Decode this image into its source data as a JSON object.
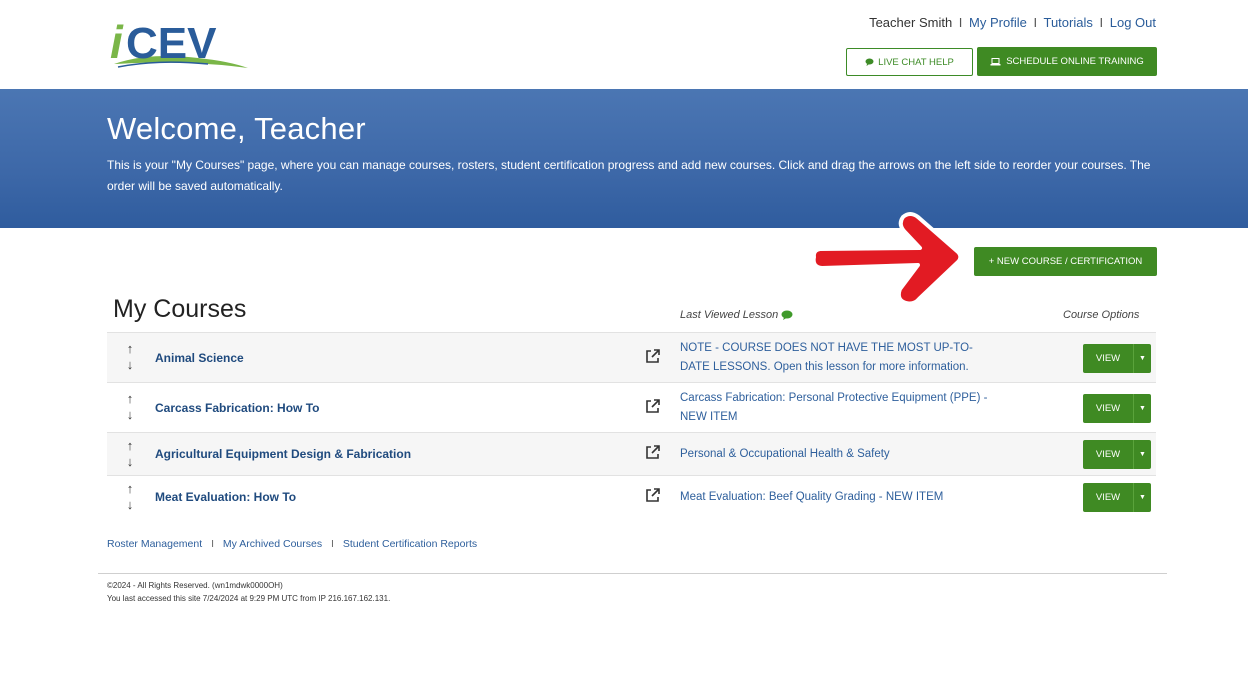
{
  "header": {
    "logo_text": "iCEV",
    "user_name": "Teacher Smith",
    "links": [
      "My Profile",
      "Tutorials",
      "Log Out"
    ],
    "separator": "I",
    "chat_label": "LIVE CHAT HELP",
    "training_label": "SCHEDULE ONLINE TRAINING",
    "brand_color": "#3f8a23"
  },
  "banner": {
    "title": "Welcome, Teacher",
    "description": "This is your \"My Courses\" page, where you can manage courses, rosters, student certification progress and add new courses. Click and drag the arrows on the left side to reorder your courses. The order will be saved automatically.",
    "color": "#3d68a8"
  },
  "actions": {
    "new_course_label": "+ NEW COURSE / CERTIFICATION",
    "annotation_color": "#e21b23"
  },
  "courses": {
    "title": "My Courses",
    "col_last_viewed": "Last Viewed Lesson",
    "col_options": "Course Options",
    "view_label": "VIEW",
    "rows": [
      {
        "name": "Animal Science",
        "lesson": "NOTE - COURSE DOES NOT HAVE THE MOST UP-TO-DATE LESSONS. Open this lesson for more information."
      },
      {
        "name": "Carcass Fabrication: How To",
        "lesson": "Carcass Fabrication: Personal Protective Equipment (PPE) - NEW ITEM"
      },
      {
        "name": "Agricultural Equipment Design & Fabrication",
        "lesson": "Personal & Occupational Health & Safety"
      },
      {
        "name": "Meat Evaluation: How To",
        "lesson": "Meat Evaluation: Beef Quality Grading - NEW ITEM"
      }
    ]
  },
  "footer": {
    "links": [
      "Roster Management",
      "My Archived Courses",
      "Student Certification Reports"
    ],
    "separator": "I",
    "copyright": "©2024 - All Rights Reserved. (wn1mdwk0000OH)",
    "last_access": "You last accessed this site 7/24/2024 at 9:29 PM UTC from IP 216.167.162.131."
  }
}
